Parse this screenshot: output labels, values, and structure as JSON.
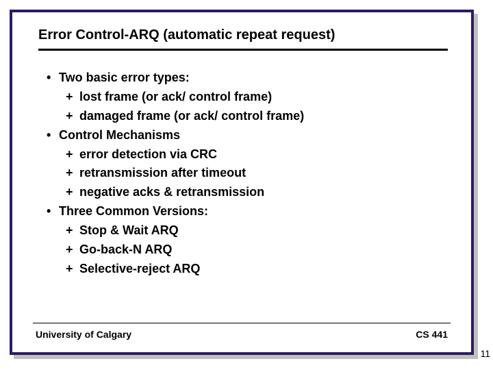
{
  "title": "Error Control-ARQ (automatic repeat request)",
  "bullets": {
    "b1": "Two basic error types:",
    "b1a": "lost frame (or ack/ control frame)",
    "b1b": "damaged frame (or ack/ control frame)",
    "b2": "Control Mechanisms",
    "b2a": "error detection via CRC",
    "b2b": "retransmission after timeout",
    "b2c": "negative acks & retransmission",
    "b3": "Three Common Versions:",
    "b3a": "Stop & Wait ARQ",
    "b3b": "Go-back-N ARQ",
    "b3c": "Selective-reject ARQ"
  },
  "footer": {
    "left": "University of Calgary",
    "right": "CS 441"
  },
  "page_number": "11"
}
